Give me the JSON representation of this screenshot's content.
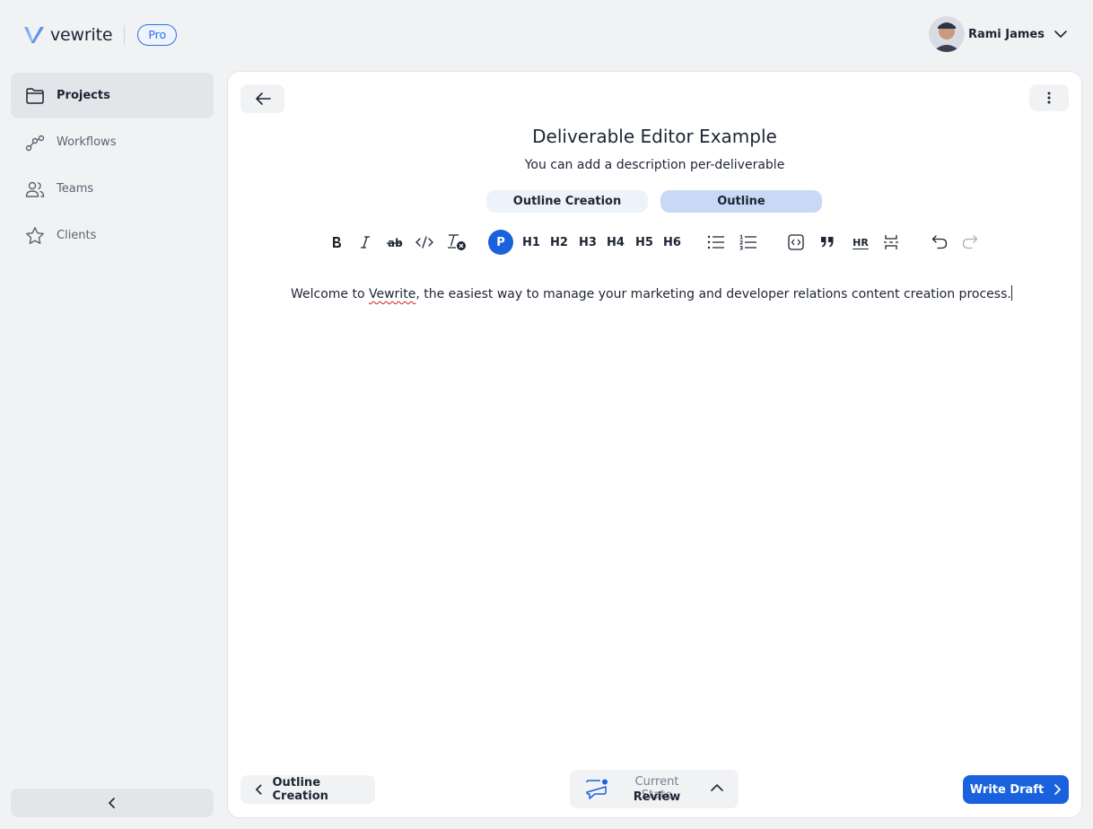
{
  "app": {
    "name": "vewrite",
    "plan_badge": "Pro"
  },
  "user": {
    "name": "Rami James"
  },
  "sidebar": {
    "items": [
      {
        "label": "Projects",
        "icon": "folder-icon",
        "active": true
      },
      {
        "label": "Workflows",
        "icon": "workflow-icon",
        "active": false
      },
      {
        "label": "Teams",
        "icon": "users-icon",
        "active": false
      },
      {
        "label": "Clients",
        "icon": "star-icon",
        "active": false
      }
    ]
  },
  "deliverable": {
    "title": "Deliverable Editor Example",
    "description": "You can add a description per-deliverable"
  },
  "tabs": [
    {
      "label": "Outline Creation",
      "state": "done"
    },
    {
      "label": "Outline",
      "state": "current"
    }
  ],
  "toolbar": {
    "paragraph": "P",
    "headings": [
      "H1",
      "H2",
      "H3",
      "H4",
      "H5",
      "H6"
    ],
    "hr_label": "HR"
  },
  "editor": {
    "text_before": "Welcome to ",
    "misspelled": "Vewrite",
    "text_after": ", the easiest way to manage your marketing and developer relations content creation process."
  },
  "footer": {
    "prev_label": "Outline Creation",
    "state_label": "Current State",
    "state_value": "Review",
    "next_label": "Write Draft"
  },
  "colors": {
    "accent": "#1a62dd",
    "tab_current": "#c9d8f5",
    "tab_done": "#eef2fb"
  }
}
